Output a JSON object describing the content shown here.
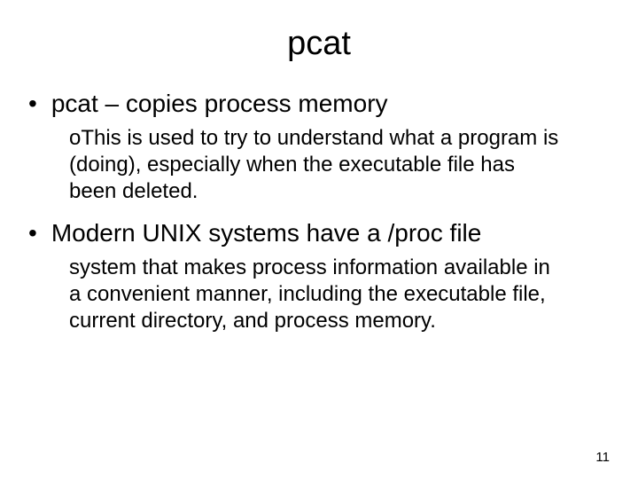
{
  "title": "pcat",
  "bullets": [
    {
      "text": "pcat – copies process memory",
      "sub": "oThis is used to try to understand what a program is (doing), especially when the executable file has been deleted."
    },
    {
      "text": "Modern UNIX systems have a /proc file",
      "sub": "system that makes process information available in a convenient manner, including the executable file, current directory, and process memory."
    }
  ],
  "page_number": "11"
}
